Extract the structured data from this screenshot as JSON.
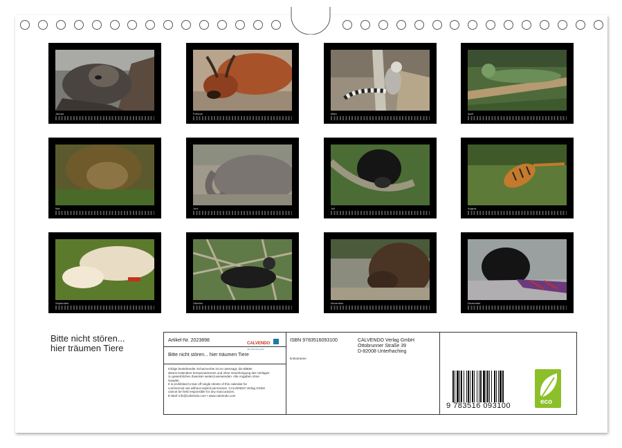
{
  "calendar": {
    "title_line1": "Bitte nicht stören...",
    "title_line2": "hier träumen Tiere",
    "months": [
      {
        "label": "Januar",
        "animal": "sloth"
      },
      {
        "label": "Februar",
        "animal": "banteng"
      },
      {
        "label": "März",
        "animal": "lemur"
      },
      {
        "label": "April",
        "animal": "iguana"
      },
      {
        "label": "Mai",
        "animal": "lion"
      },
      {
        "label": "Juni",
        "animal": "elephant"
      },
      {
        "label": "Juli",
        "animal": "bear-hammock"
      },
      {
        "label": "August",
        "animal": "tiger"
      },
      {
        "label": "September",
        "animal": "dog"
      },
      {
        "label": "Oktober",
        "animal": "ape-hammock"
      },
      {
        "label": "November",
        "animal": "brown-bear"
      },
      {
        "label": "Dezember",
        "animal": "gorilla"
      }
    ]
  },
  "info": {
    "article_label": "Artikel-Nr. 2023898",
    "brand": "CALVENDO",
    "brand_sub": "das kalenderportal",
    "subtitle": "Bitte nicht stören... hier träumen Tiere",
    "isbn": "ISBN 9783516093100",
    "publisher_line1": "CALVENDO Verlag GmbH",
    "publisher_line2": "Ottobrunner Straße 39",
    "publisher_line3": "D-82008 Unterhaching",
    "author": "krokotraene",
    "legal_1": "Infolge bestehender Schutzrechte ist es untersagt, die Blätter",
    "legal_2": "dieses Kalenders herauszutrennen und ohne Genehmigung des Verlages",
    "legal_3": "zu gewerblichen Zwecken weiterzuverwenden. Alle Angaben ohne",
    "legal_4": "Gewähr.",
    "legal_5": "It is prohibited to tear off single sheets of this calendar for",
    "legal_6": "commercial use without explicit permission. CALVENDO Verlag GmbH",
    "legal_7": "cannot be held responsible for any inaccuracies.",
    "legal_8": "E-Mail: info@calvendo.com • www.calvendo.com",
    "barcode_digits": "9 783516 093100",
    "eco_label": "eco"
  }
}
